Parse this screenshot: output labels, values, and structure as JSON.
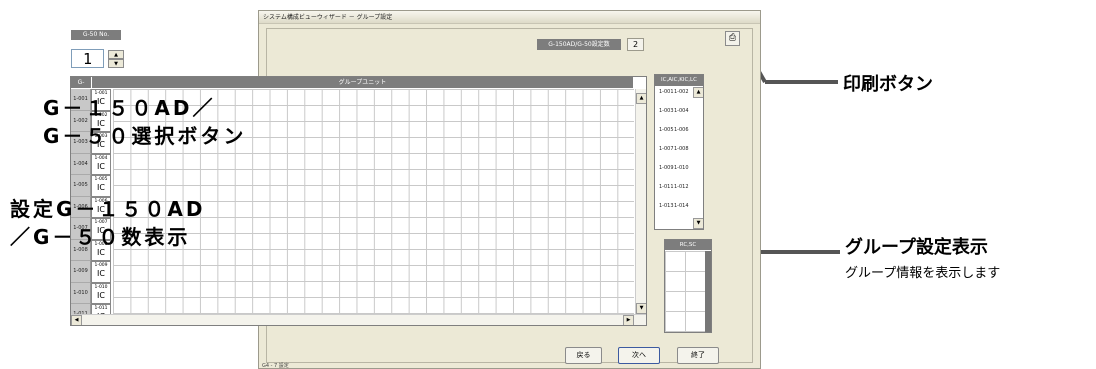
{
  "window": {
    "title": "システム構成ビューウィザード － グループ設定",
    "status": "G4 - 7 設定"
  },
  "g50": {
    "label": "G-50 No.",
    "value": "1",
    "up_icon": "triangle-up-icon",
    "down_icon": "triangle-down-icon"
  },
  "count": {
    "label": "G-150AD/G-50設定数",
    "value": "2"
  },
  "print_icon": "printer-icon",
  "grid": {
    "header_first": "G-",
    "header_main": "グループユニット",
    "rows": [
      {
        "group": "1-001",
        "unit": "1-001",
        "type": "IC"
      },
      {
        "group": "1-002",
        "unit": "1-002",
        "type": "IC"
      },
      {
        "group": "1-003",
        "unit": "1-003",
        "type": "IC"
      },
      {
        "group": "1-004",
        "unit": "1-004",
        "type": "IC"
      },
      {
        "group": "1-005",
        "unit": "1-005",
        "type": "IC"
      },
      {
        "group": "1-006",
        "unit": "1-006",
        "type": "IC"
      },
      {
        "group": "1-007",
        "unit": "1-007",
        "type": "IC"
      },
      {
        "group": "1-008",
        "unit": "1-008",
        "type": "IC"
      },
      {
        "group": "1-009",
        "unit": "1-009",
        "type": "IC"
      },
      {
        "group": "1-010",
        "unit": "1-010",
        "type": "IC"
      },
      {
        "group": "1-011",
        "unit": "1-011",
        "type": "IC"
      }
    ]
  },
  "side_list": {
    "header": "IC,AIC,KIC,LC",
    "items": [
      "1-001",
      "1-002",
      "1-003",
      "1-004",
      "1-005",
      "1-006",
      "1-007",
      "1-008",
      "1-009",
      "1-010",
      "1-011",
      "1-012",
      "1-013",
      "1-014"
    ]
  },
  "rcsc": {
    "header": "RC,SC"
  },
  "buttons": {
    "back": "戻る",
    "next": "次へ",
    "exit": "終了"
  },
  "annotations": {
    "select_button_line1": "G－１５０AD／",
    "select_button_line2": "G－５０選択ボタン",
    "count_line1": "設定G－１５０AD",
    "count_line2": "／G－５０数表示",
    "print_button": "印刷ボタン",
    "group_display": "グループ設定表示",
    "group_display_sub": "グループ情報を表示します"
  }
}
